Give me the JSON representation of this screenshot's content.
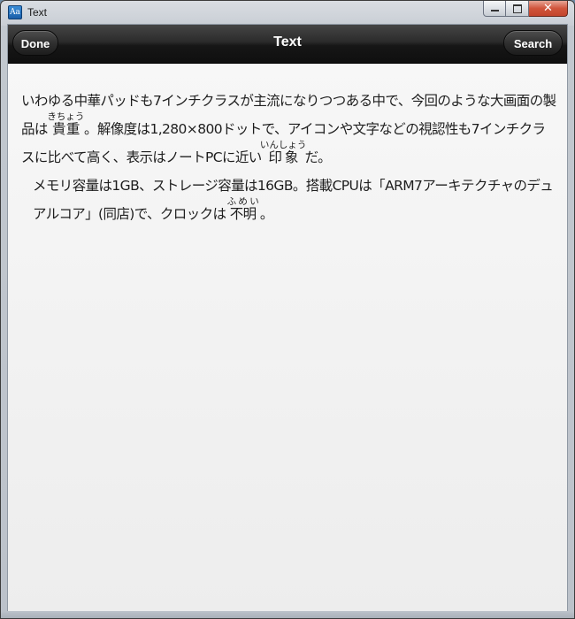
{
  "window": {
    "title": "Text",
    "icon": "text-app-icon",
    "icon_glyph": "Aa",
    "close_glyph": "✕"
  },
  "navbar": {
    "title": "Text",
    "done_label": "Done",
    "search_label": "Search"
  },
  "article": {
    "p1_seg1": "いわゆる中華パッドも7インチクラスが主流になりつつある中で、今回のような大画面の製品は",
    "p1_ruby1_base": "貴重",
    "p1_ruby1_reading": "きちょう",
    "p1_seg2": "。解像度は1,280×800ドットで、アイコンや文字などの視認性も7インチクラスに比べて高く、表示はノートPCに近い",
    "p1_ruby2_base": "印象",
    "p1_ruby2_reading": "いんしょう",
    "p1_seg3": "だ。",
    "p2_seg1": "メモリ容量は1GB、ストレージ容量は16GB。搭載CPUは「ARM7アーキテクチャのデュアルコア」(同店)で、クロックは",
    "p2_ruby1_base": "不明",
    "p2_ruby1_reading": "ふめい",
    "p2_seg2": "。"
  },
  "colors": {
    "navbar_dark": "#161616",
    "content_bg": "#f3f3f3",
    "text": "#1e1e1e",
    "close_red": "#c3452c"
  }
}
